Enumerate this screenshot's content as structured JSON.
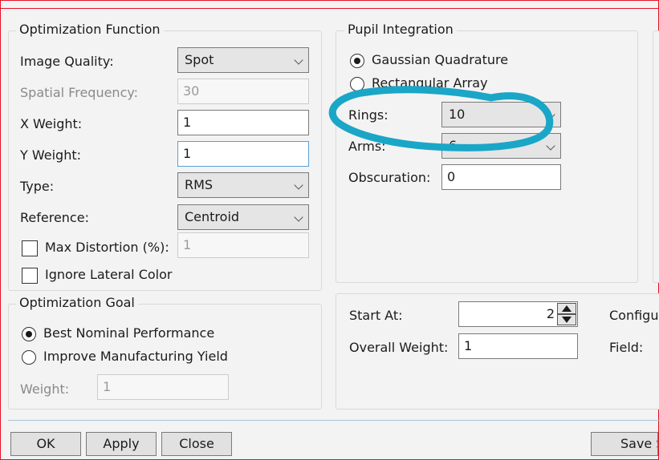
{
  "optimization_function": {
    "legend": "Optimization Function",
    "image_quality": {
      "label": "Image Quality:",
      "value": "Spot"
    },
    "spatial_frequency": {
      "label": "Spatial Frequency:",
      "value": "30"
    },
    "x_weight": {
      "label": "X Weight:",
      "value": "1"
    },
    "y_weight": {
      "label": "Y Weight:",
      "value": "1"
    },
    "type": {
      "label": "Type:",
      "value": "RMS"
    },
    "reference": {
      "label": "Reference:",
      "value": "Centroid"
    },
    "max_distortion": {
      "label": "Max Distortion (%):",
      "value": "1"
    },
    "ignore_lateral_color": {
      "label": "Ignore Lateral Color"
    }
  },
  "pupil_integration": {
    "legend": "Pupil Integration",
    "gaussian_quadrature": "Gaussian Quadrature",
    "rectangular_array": "Rectangular Array",
    "rings": {
      "label": "Rings:",
      "value": "10"
    },
    "arms": {
      "label": "Arms:",
      "value": "6"
    },
    "obscuration": {
      "label": "Obscuration:",
      "value": "0"
    }
  },
  "optimization_goal": {
    "legend": "Optimization Goal",
    "best_nominal": "Best Nominal Performance",
    "improve_yield": "Improve Manufacturing Yield",
    "weight": {
      "label": "Weight:",
      "value": "1"
    }
  },
  "operands": {
    "start_at": {
      "label": "Start At:",
      "value": "2"
    },
    "overall_weight": {
      "label": "Overall Weight:",
      "value": "1"
    },
    "configuration_label": "Configu",
    "field_label": "Field:"
  },
  "buttons": {
    "ok": "OK",
    "apply": "Apply",
    "close": "Close",
    "save": "Save S"
  },
  "colors": {
    "annotation": "#1aa6c7",
    "frame": "#e81123"
  }
}
